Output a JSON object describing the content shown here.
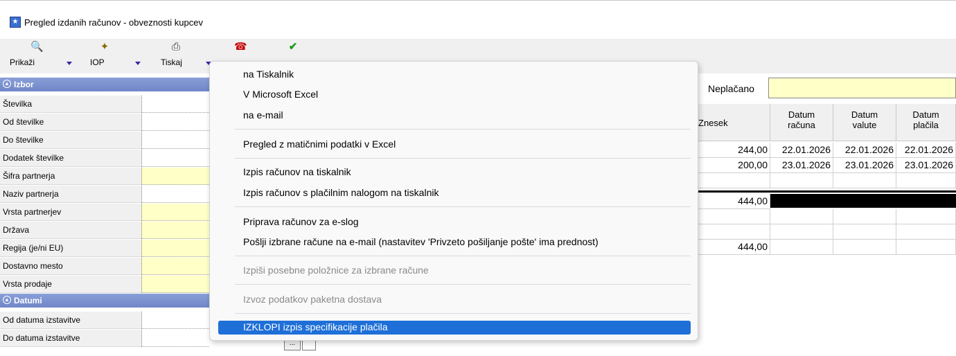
{
  "window": {
    "title": "Pregled izdanih računov - obveznosti kupcev"
  },
  "toolbar": {
    "items": [
      {
        "label": "Prikaži",
        "icon": "preview-icon"
      },
      {
        "label": "IOP",
        "icon": "iop-icon"
      },
      {
        "label": "Tiskaj",
        "icon": "printer-icon"
      },
      {
        "label": "",
        "icon": "phone-icon"
      },
      {
        "label": "",
        "icon": "checkmark-icon"
      }
    ]
  },
  "left_panel": {
    "section_izbor": "Izbor",
    "izbor_fields": [
      {
        "label": "Številka",
        "highlight": false
      },
      {
        "label": "Od številke",
        "highlight": false
      },
      {
        "label": "Do številke",
        "highlight": false
      },
      {
        "label": "Dodatek številke",
        "highlight": false
      },
      {
        "label": "Šifra partnerja",
        "highlight": true
      },
      {
        "label": "Naziv partnerja",
        "highlight": false
      },
      {
        "label": "Vrsta partnerjev",
        "highlight": true
      },
      {
        "label": "Država",
        "highlight": true
      },
      {
        "label": "Regija (je/ni EU)",
        "highlight": true
      },
      {
        "label": "Dostavno mesto",
        "highlight": true
      },
      {
        "label": "Vrsta prodaje",
        "highlight": true
      }
    ],
    "section_datumi": "Datumi",
    "datumi_fields": [
      {
        "label": "Od datuma izstavitve"
      },
      {
        "label": "Do datuma izstavitve"
      }
    ],
    "date_button": "..."
  },
  "filter": {
    "neplacano_label": "Neplačano",
    "neplacano_value": ""
  },
  "grid": {
    "headers": {
      "znesek": "Znesek",
      "datum_racuna": [
        "Datum",
        "računa"
      ],
      "datum_valute": [
        "Datum",
        "valute"
      ],
      "datum_placila": [
        "Datum",
        "plačila"
      ]
    },
    "rows": [
      {
        "znesek": "244,00",
        "datum_racuna": "22.01.2026",
        "datum_valute": "22.01.2026",
        "datum_placila": "22.01.2026"
      },
      {
        "znesek": "200,00",
        "datum_racuna": "23.01.2026",
        "datum_valute": "23.01.2026",
        "datum_placila": "23.01.2026"
      }
    ],
    "total": "444,00",
    "total_bottom": "444,00"
  },
  "context_menu": {
    "items": [
      {
        "label": "na Tiskalnik",
        "enabled": true
      },
      {
        "label": "V Microsoft Excel",
        "enabled": true
      },
      {
        "label": "na e-mail",
        "enabled": true
      },
      {
        "label": "Pregled z matičnimi podatki v Excel",
        "enabled": true
      },
      {
        "label": "Izpis računov na tiskalnik",
        "enabled": true
      },
      {
        "label": "Izpis računov s plačilnim nalogom na tiskalnik",
        "enabled": true
      },
      {
        "label": "Priprava računov za e-slog",
        "enabled": true
      },
      {
        "label": "Pošlji izbrane račune na e-mail (nastavitev 'Privzeto pošiljanje pošte' ima prednost)",
        "enabled": true
      },
      {
        "label": "Izpiši posebne položnice za izbrane račune",
        "enabled": false
      },
      {
        "label": "Izvoz podatkov paketna dostava",
        "enabled": false
      },
      {
        "label": "IZKLOPI izpis specifikacije plačila",
        "enabled": true,
        "highlighted": true
      }
    ]
  },
  "colors": {
    "accent": "#1e6fd8",
    "section_header": "#7a90cf",
    "input_yellow": "#ffffc8",
    "dropdown_arrow": "#3b22a8"
  }
}
